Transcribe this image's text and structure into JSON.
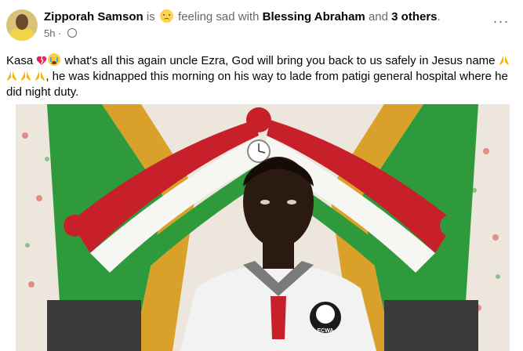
{
  "post": {
    "author": "Zipporah Samson",
    "is_text": "is",
    "feeling": "feeling sad with",
    "tagged": "Blessing Abraham",
    "and_text": "and",
    "others": "3 others",
    "period": ".",
    "time": "5h",
    "dot": "·",
    "audience_icon": "globe-icon",
    "more_icon": "more-options-icon",
    "more_label": "···",
    "body_1": "Kasa",
    "body_2": "what's all this again uncle Ezra, God will bring you back to us safely in Jesus name",
    "body_3": ", he was kidnapped this morning on his way to lade from patigi general hospital where he did night duty."
  },
  "photo": {
    "shirt_badge_text": "ECWA",
    "colors": {
      "green": "#2f9a3c",
      "red": "#c8202a",
      "gold": "#d9a12a",
      "white": "#f6f6f2"
    }
  }
}
